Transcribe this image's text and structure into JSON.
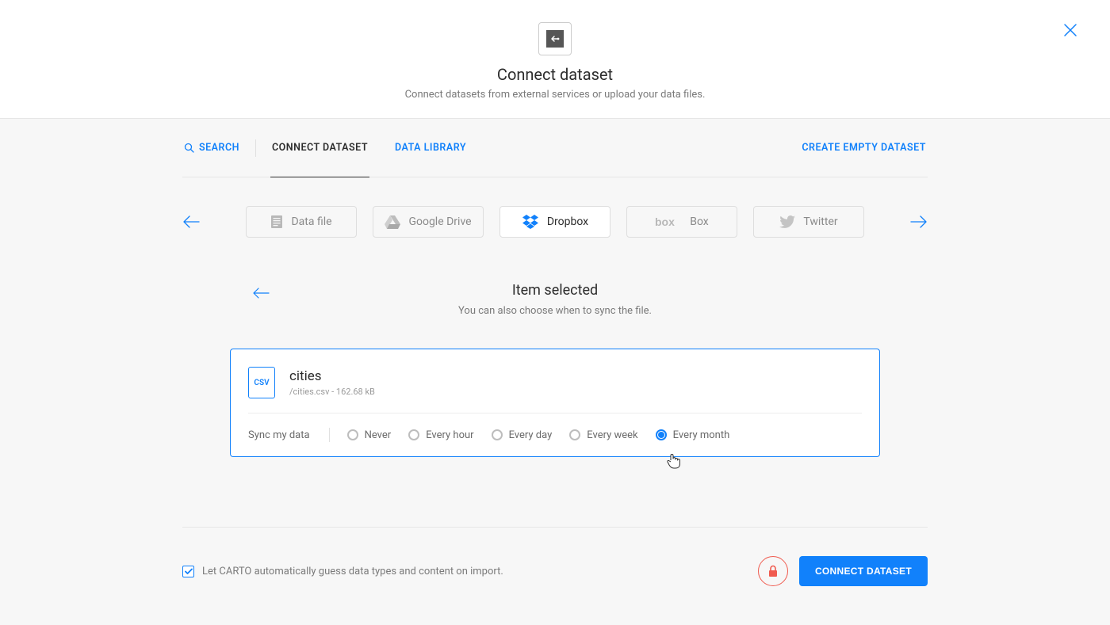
{
  "header": {
    "title": "Connect dataset",
    "subtitle": "Connect datasets from external services or upload your data files."
  },
  "tabs": {
    "search": "SEARCH",
    "connect": "CONNECT DATASET",
    "library": "DATA LIBRARY",
    "create_empty": "CREATE EMPTY DATASET"
  },
  "connectors": {
    "datafile": "Data file",
    "gdrive": "Google Drive",
    "dropbox": "Dropbox",
    "box": "Box",
    "twitter": "Twitter"
  },
  "item": {
    "title": "Item selected",
    "desc": "You can also choose when to sync the file.",
    "file_badge": "CSV",
    "file_name": "cities",
    "file_meta": "/cities.csv - 162.68 kB"
  },
  "sync": {
    "label": "Sync my data",
    "never": "Never",
    "every_hour": "Every hour",
    "every_day": "Every day",
    "every_week": "Every week",
    "every_month": "Every month"
  },
  "footer": {
    "guess_text": "Let CARTO automatically guess data types and content on import.",
    "connect_button": "CONNECT DATASET"
  }
}
